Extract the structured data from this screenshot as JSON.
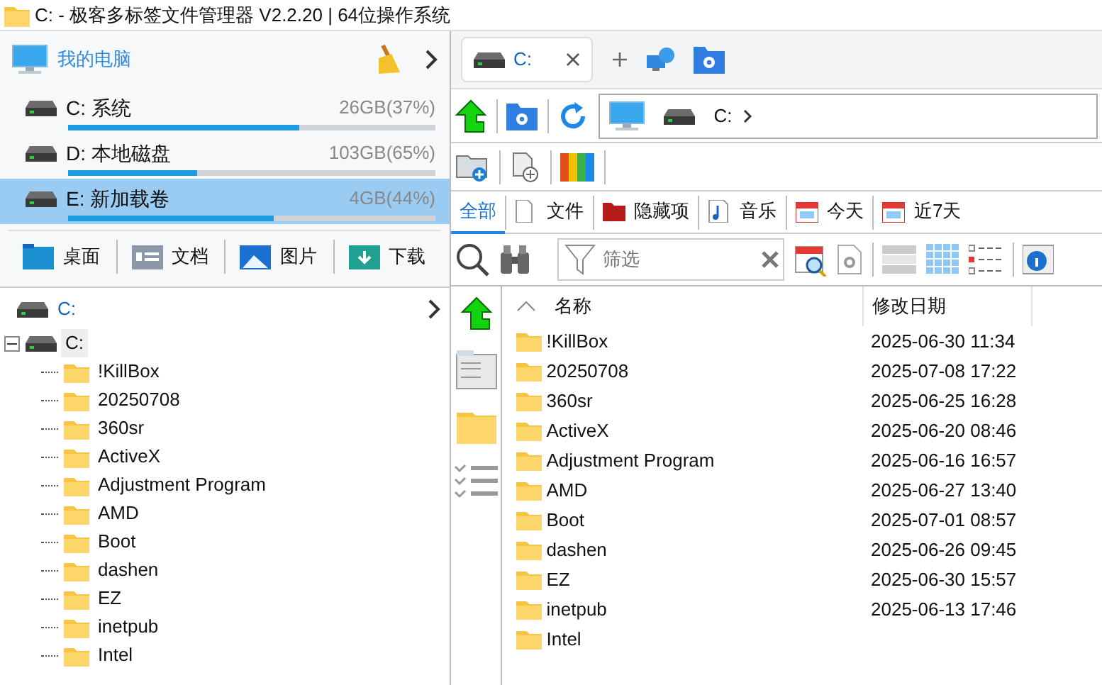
{
  "window": {
    "title": "C: - 极客多标签文件管理器 V2.2.20 | 64位操作系统"
  },
  "computer": {
    "label": "我的电脑"
  },
  "drives": [
    {
      "name": "C: 系统",
      "usage": "26GB(37%)",
      "level": 0.63,
      "selected": false
    },
    {
      "name": "D: 本地磁盘",
      "usage": "103GB(65%)",
      "level": 0.35,
      "selected": false
    },
    {
      "name": "E: 新加载卷",
      "usage": "4GB(44%)",
      "level": 0.56,
      "selected": true
    }
  ],
  "shortcuts": [
    {
      "label": "桌面",
      "kind": "desktop"
    },
    {
      "label": "文档",
      "kind": "documents"
    },
    {
      "label": "图片",
      "kind": "pictures"
    },
    {
      "label": "下载",
      "kind": "downloads"
    }
  ],
  "tree_tab": {
    "label": "C:"
  },
  "tree": {
    "label": "C:",
    "expanded": true,
    "children": [
      {
        "label": "!KillBox"
      },
      {
        "label": "20250708"
      },
      {
        "label": "360sr"
      },
      {
        "label": "ActiveX"
      },
      {
        "label": "Adjustment Program"
      },
      {
        "label": "AMD"
      },
      {
        "label": "Boot"
      },
      {
        "label": "dashen"
      },
      {
        "label": "EZ"
      },
      {
        "label": "inetpub"
      },
      {
        "label": "Intel"
      }
    ]
  },
  "tabs": [
    {
      "label": "C:",
      "selected": true
    }
  ],
  "address": {
    "path": "C:"
  },
  "filters": [
    {
      "label": "全部",
      "kind": "all",
      "selected": true
    },
    {
      "label": "文件",
      "kind": "file",
      "selected": false
    },
    {
      "label": "隐藏项",
      "kind": "hidden",
      "selected": false
    },
    {
      "label": "音乐",
      "kind": "music",
      "selected": false
    },
    {
      "label": "今天",
      "kind": "today",
      "selected": false
    },
    {
      "label": "近7天",
      "kind": "week",
      "selected": false
    }
  ],
  "filter_field": {
    "placeholder": "筛选"
  },
  "columns": [
    "名称",
    "修改日期"
  ],
  "files": [
    {
      "name": "!KillBox",
      "modified": "2025-06-30 11:34"
    },
    {
      "name": "20250708",
      "modified": "2025-07-08 17:22"
    },
    {
      "name": "360sr",
      "modified": "2025-06-25 16:28"
    },
    {
      "name": "ActiveX",
      "modified": "2025-06-20 08:46"
    },
    {
      "name": "Adjustment Program",
      "modified": "2025-06-16 16:57"
    },
    {
      "name": "AMD",
      "modified": "2025-06-27 13:40"
    },
    {
      "name": "Boot",
      "modified": "2025-07-01 08:57"
    },
    {
      "name": "dashen",
      "modified": "2025-06-26 09:45"
    },
    {
      "name": "EZ",
      "modified": "2025-06-30 15:57"
    },
    {
      "name": "inetpub",
      "modified": "2025-06-13 17:46"
    },
    {
      "name": "Intel"
    }
  ]
}
